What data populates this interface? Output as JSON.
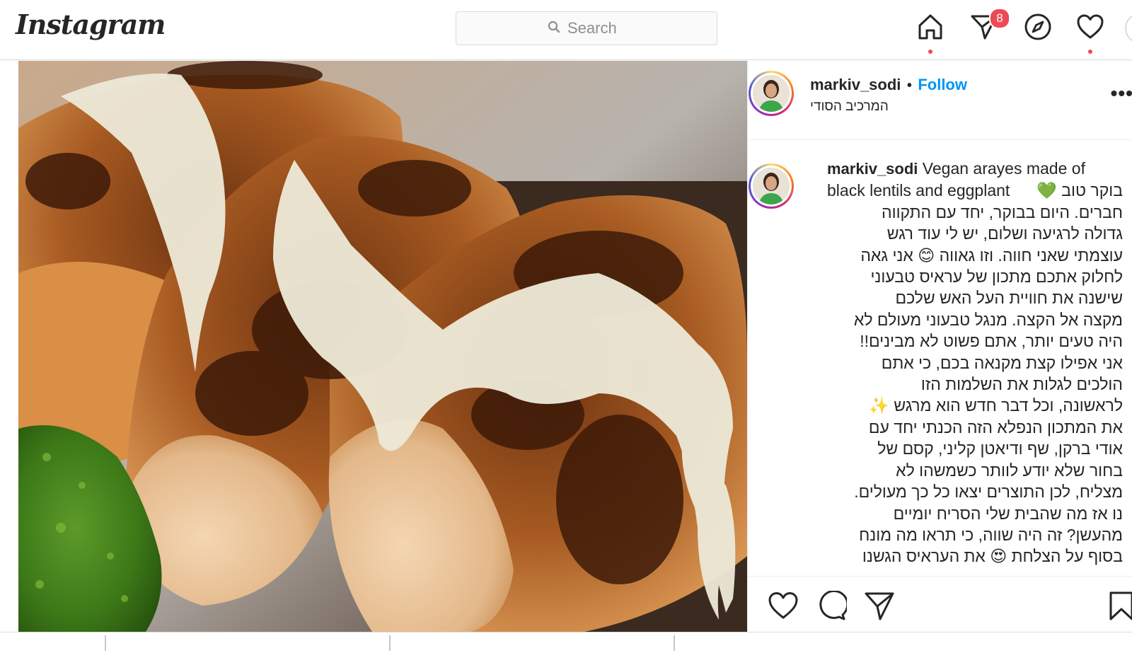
{
  "app": {
    "logo_text": "Instagram"
  },
  "search": {
    "placeholder": "Search"
  },
  "nav": {
    "icons": [
      "home-icon",
      "direct-messages-icon",
      "explore-compass-icon",
      "activity-heart-icon",
      "profile-avatar"
    ],
    "messages_badge": "8"
  },
  "post": {
    "author": {
      "username": "markiv_sodi",
      "separator": "•",
      "follow_label": "Follow",
      "display_name": "המרכיב הסודי"
    },
    "image_alt": "Vegan arayes with white tahini sauce and green herb sauce",
    "caption": {
      "username": "markiv_sodi",
      "english_text": "Vegan arayes made of black lentils and eggplant",
      "lines": [
        "בוקר טוב 💚",
        "חברים. היום בבוקר, יחד עם התקווה",
        "גדולה לרגיעה ושלום, יש לי עוד רגש",
        "עוצמתי שאני חווה. וזו גאווה 😊 אני גאה",
        "לחלוק אתכם מתכון של עראיס טבעוני",
        "שישנה את חוויית העל האש שלכם",
        "מקצה אל הקצה. מנגל טבעוני מעולם לא",
        "היה טעים יותר, אתם פשוט לא מבינים!!",
        "אני אפילו קצת מקנאה בכם, כי אתם",
        "הולכים לגלות את השלמות הזו",
        "לראשונה, וכל דבר חדש הוא מרגש ✨",
        "את המתכון הנפלא הזה הכנתי יחד עם",
        "אודי ברקן, שף ודיאטן קליני, קסם של",
        "בחור שלא יודע לוותר כשמשהו לא",
        "מצליח, לכן התוצרים יצאו כל כך מעולים.",
        "נו אז מה שהבית שלי הסריח יומיים",
        "מהעשן? זה היה שווה, כי תראו מה מונח",
        "בסוף על הצלחת 😍 את העראיס הגשנו"
      ]
    },
    "actions": [
      "like-heart-icon",
      "comment-icon",
      "share-icon",
      "save-bookmark-icon"
    ]
  },
  "colors": {
    "link_blue": "#0095f6",
    "notification_red": "#ed4956",
    "border_gray": "#dbdbdb",
    "text_dark": "#262626"
  }
}
